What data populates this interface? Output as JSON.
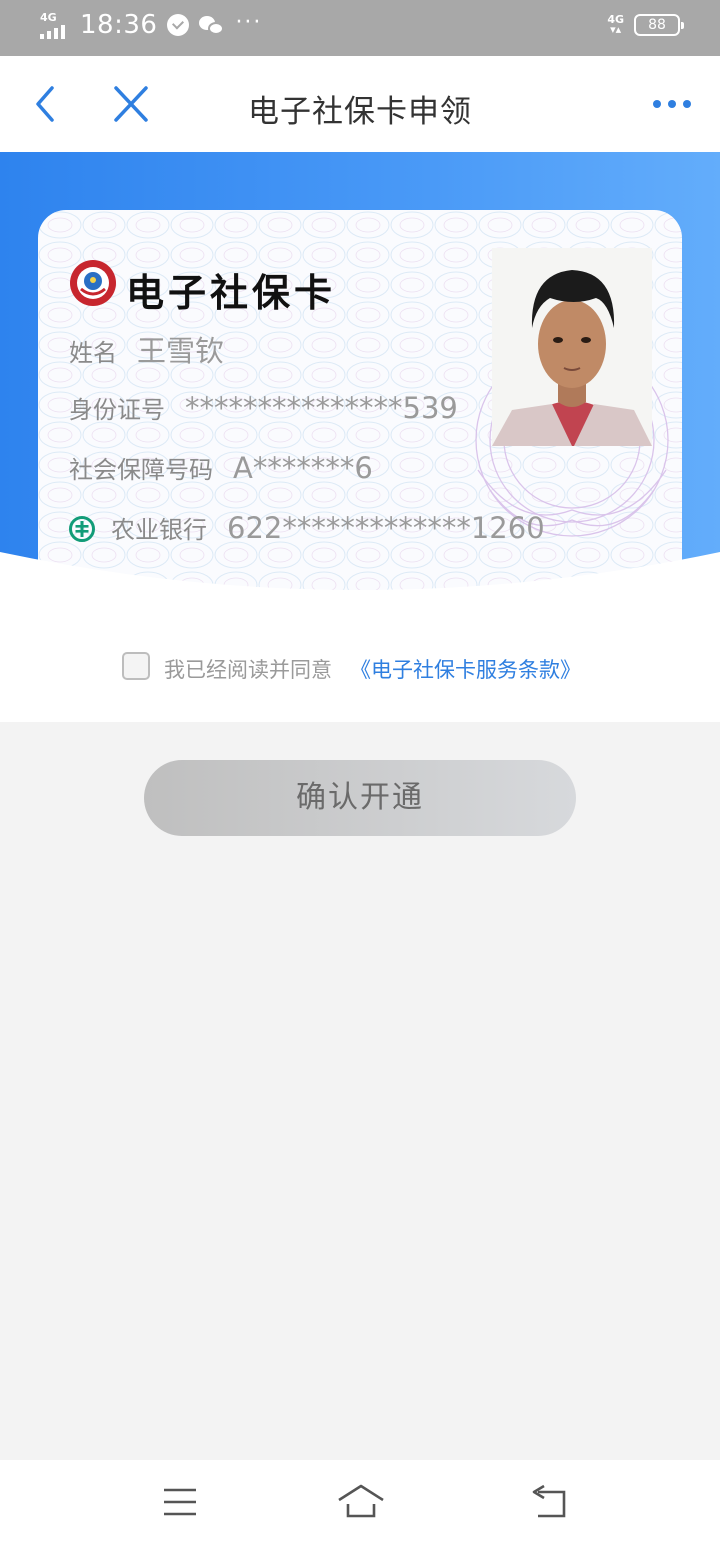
{
  "status_bar": {
    "network_left": "4G",
    "time": "18:36",
    "more": "···",
    "network_right": "4G",
    "battery": "88"
  },
  "nav": {
    "title": "电子社保卡申领"
  },
  "card": {
    "title": "电子社保卡",
    "name_label": "姓名",
    "name_value": "王雪钦",
    "id_label": "身份证号",
    "id_value": "***************539",
    "ss_label": "社会保障号码",
    "ss_value": "A*******6",
    "bank_label": "农业银行",
    "bank_value": "622*************1260"
  },
  "agreement": {
    "text": "我已经阅读并同意",
    "link": "《电子社保卡服务条款》",
    "checked": false
  },
  "confirm_button": "确认开通",
  "colors": {
    "accent": "#2e83ee",
    "link": "#2f7fe0",
    "status_bar": "#a8a8a8",
    "button_disabled": "#c8c9cb"
  }
}
